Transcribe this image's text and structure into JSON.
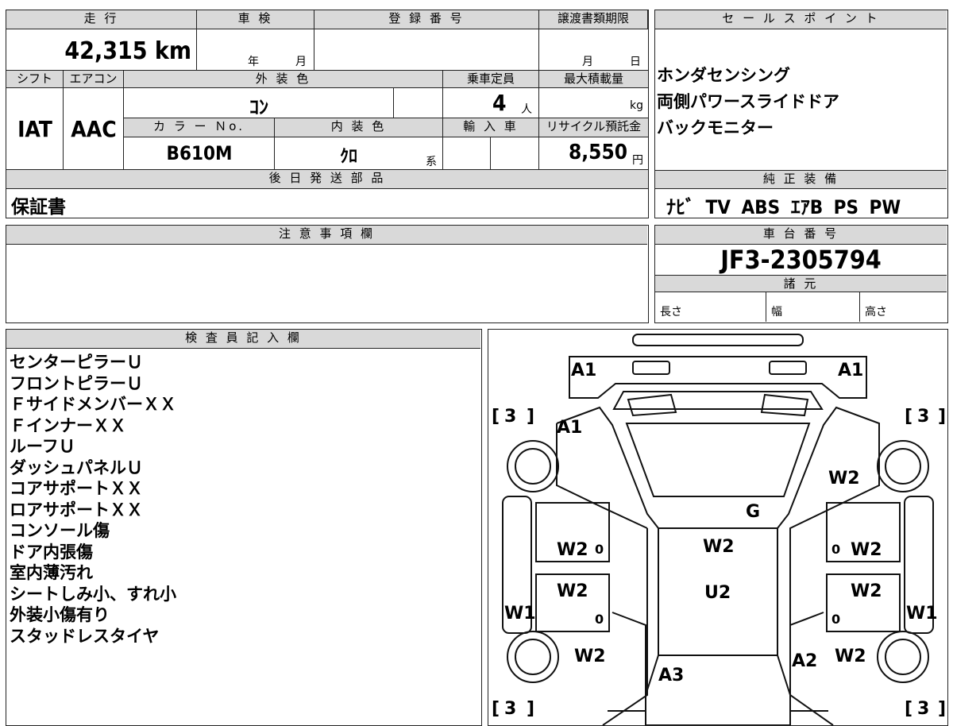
{
  "specs": {
    "mileage_header": "走 行",
    "mileage_value": "42,315 km",
    "inspection_header": "車 検",
    "inspection_year": "年",
    "inspection_month": "月",
    "registration_header": "登 録 番 号",
    "transfer_header": "譲渡書類期限",
    "transfer_month": "月",
    "transfer_day": "日",
    "shift_header": "シフト",
    "shift_value": "IAT",
    "ac_header": "エアコン",
    "ac_value": "AAC",
    "exterior_color_header": "外 装 色",
    "exterior_color_value": "ｺﾝ",
    "capacity_header": "乗車定員",
    "capacity_value": "4",
    "capacity_unit": "人",
    "max_load_header": "最大積載量",
    "max_load_unit": "kg",
    "color_no_header": "カ ラ ー Ｎo.",
    "color_no_value": "B610M",
    "interior_color_header": "内 装 色",
    "interior_color_value": "ｸﾛ",
    "interior_color_suffix": "系",
    "import_header": "輸 入 車",
    "recycle_header": "リサイクル預託金",
    "recycle_value": "8,550",
    "recycle_unit": "円",
    "later_parts_header": "後 日 発 送 部 品",
    "later_parts_value": "保証書"
  },
  "sales_points": {
    "header": "セ ー ル ス ポ イ ン ト",
    "items": [
      "ホンダセンシング",
      "両側パワースライドドア",
      "バックモニター"
    ]
  },
  "equipment": {
    "header": "純 正 装 備",
    "value": "ﾅﾋﾞ TV ABS ｴｱB PS PW"
  },
  "notes": {
    "header": "注 意 事 項 欄"
  },
  "chassis": {
    "header": "車 台 番 号",
    "value": "JF3-2305794",
    "specs_header": "諸 元",
    "length_label": "長さ",
    "width_label": "幅",
    "height_label": "高さ"
  },
  "inspector": {
    "header": "検 査 員 記 入 欄",
    "items": [
      "センターピラーＵ",
      "フロントピラーＵ",
      "ＦサイドメンバーＸＸ",
      "ＦインナーＸＸ",
      "ルーフＵ",
      "ダッシュパネルＵ",
      "コアサポートＸＸ",
      "ロアサポートＸＸ",
      "コンソール傷",
      "ドア内張傷",
      "室内薄汚れ",
      "シートしみ小、すれ小",
      "外装小傷有り",
      "スタッドレスタイヤ"
    ]
  },
  "diagram_marks": {
    "front_left": "A1",
    "front_right": "A1",
    "hood_left": "A1",
    "tread_fl": "3",
    "tread_fr": "3",
    "tread_rl": "3",
    "tread_rr": "3",
    "fender_fr": "W2",
    "windshield": "G",
    "door_fl": "W2",
    "door_fl_zero": "0",
    "door_fr": "W2",
    "door_fr_zero": "0",
    "roof": "W2",
    "roof_rear": "U2",
    "door_rl": "W2",
    "door_rl_zero": "0",
    "door_rr": "W2",
    "door_rr_zero": "0",
    "side_l": "W1",
    "side_r": "W1",
    "rear_fender_l": "W2",
    "rear_fender_r": "W2",
    "rear_left": "A3",
    "rear_right": "A2"
  }
}
